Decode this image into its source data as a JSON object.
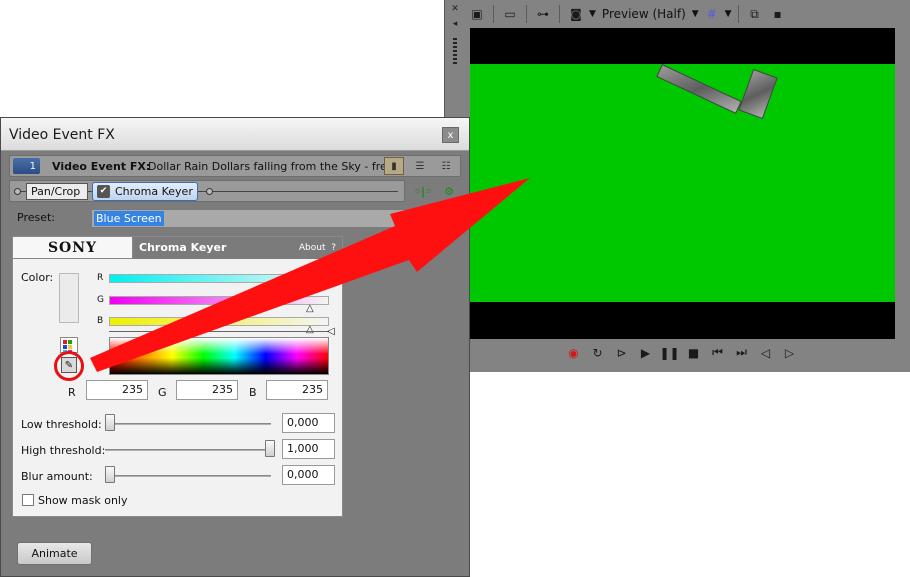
{
  "preview": {
    "mode_label": "Preview (Half)",
    "toolbar_icons": [
      "external-monitor-icon",
      "video-preview-icon",
      "split-screen-icon",
      "overlays-icon",
      "grid-icon",
      "copy-snapshot-icon",
      "save-snapshot-icon"
    ],
    "transport_icons": [
      "record-icon",
      "loop-icon",
      "play-from-start-icon",
      "play-icon",
      "pause-icon",
      "stop-icon",
      "prev-frame-icon",
      "next-frame-icon",
      "prev-marker-icon",
      "next-marker-icon"
    ],
    "background_color": "#00c800"
  },
  "dialog": {
    "title": "Video Event FX",
    "close_label": "x",
    "fx_number": "1",
    "fx_label": "Video Event FX:",
    "fx_name": "Dollar Rain Dollars falling from the Sky - free",
    "chain": {
      "items": [
        "Pan/Crop",
        "Chroma Keyer"
      ],
      "selected": "Chroma Keyer"
    },
    "preset_label": "Preset:",
    "preset_value": "Blue Screen",
    "plugin": {
      "brand": "SONY",
      "name": "Chroma Keyer",
      "about_label": "About",
      "about_help": "?",
      "color_label": "Color:",
      "channels": [
        "R",
        "G",
        "B"
      ],
      "rgb_labels": [
        "R",
        "G",
        "B"
      ],
      "r_value": "235",
      "g_value": "235",
      "b_value": "235",
      "low_threshold_label": "Low threshold:",
      "low_threshold_value": "0,000",
      "low_threshold_level": 0.0,
      "high_threshold_label": "High threshold:",
      "high_threshold_value": "1,000",
      "high_threshold_level": 1.0,
      "blur_label": "Blur amount:",
      "blur_value": "0,000",
      "blur_level": 0.0,
      "show_mask_label": "Show mask only",
      "show_mask_checked": false
    },
    "animate_label": "Animate"
  },
  "colors": {
    "annotation_arrow": "#ff1010",
    "highlight_ring": "#e81010",
    "selection": "#3584e4"
  }
}
